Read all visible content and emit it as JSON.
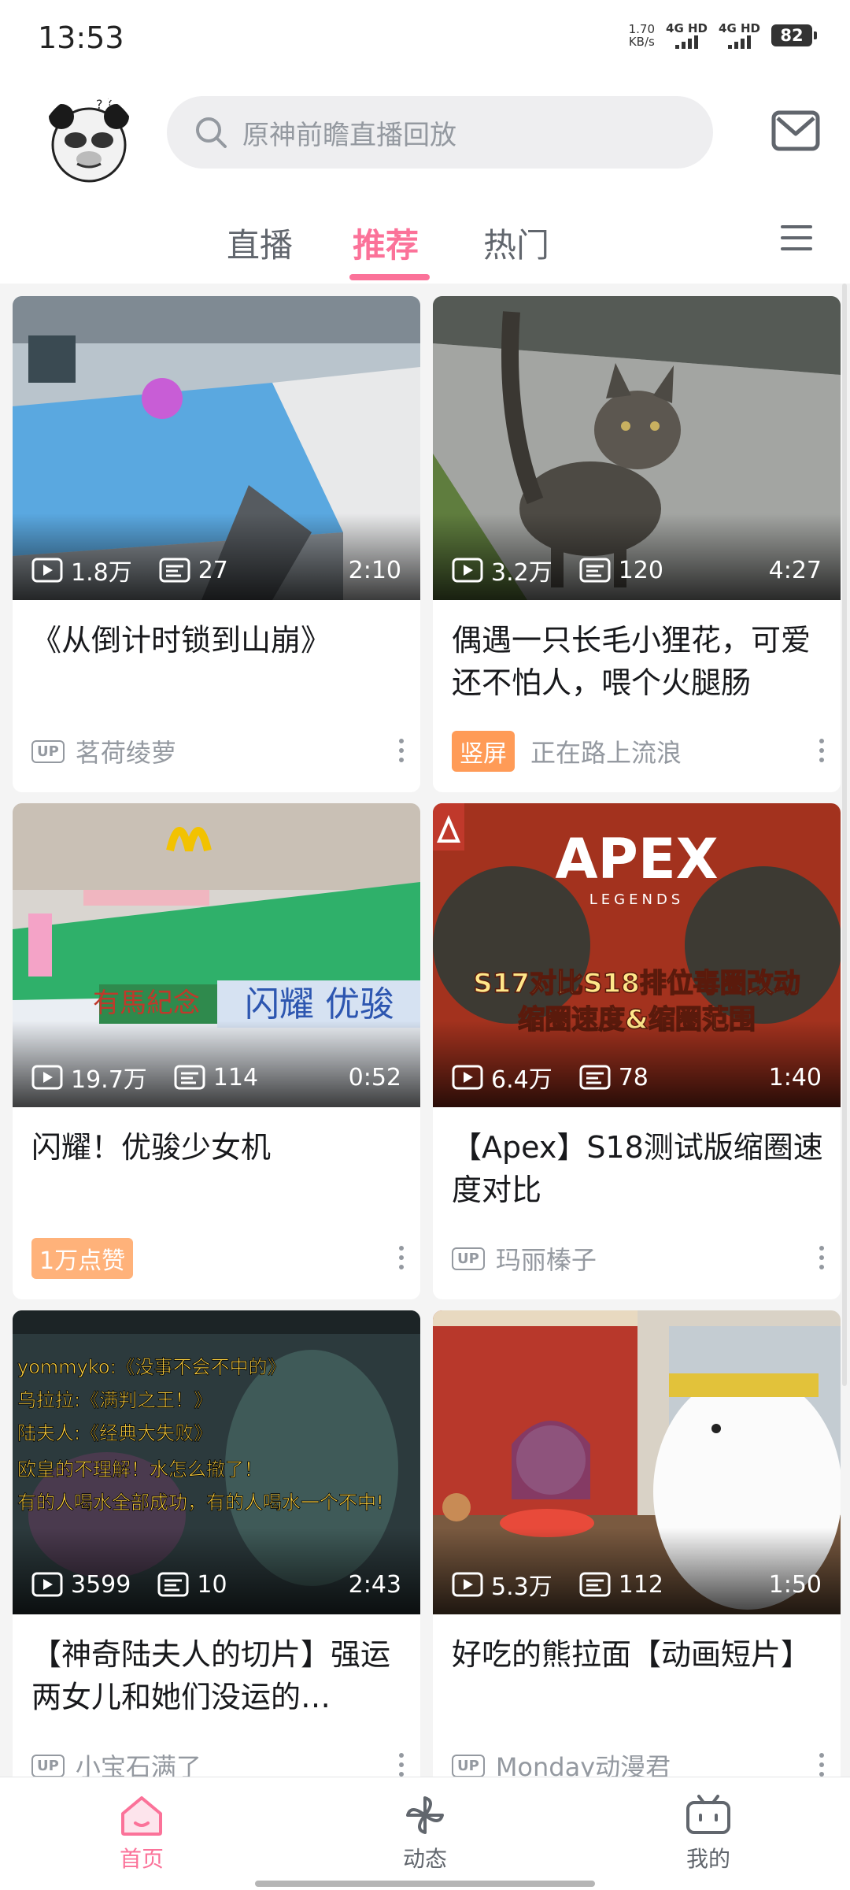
{
  "status_bar": {
    "time": "13:53",
    "net_speed_value": "1.70",
    "net_speed_unit": "KB/s",
    "sig1": "4G HD",
    "sig2": "4G HD",
    "battery": "82"
  },
  "header": {
    "search_placeholder": "原神前瞻直播回放"
  },
  "tabs": [
    {
      "label": "直播"
    },
    {
      "label": "推荐"
    },
    {
      "label": "热门"
    }
  ],
  "active_tab": "推荐",
  "accent_color": "#fb7299",
  "feed": [
    {
      "views": "1.8万",
      "comments": "27",
      "duration": "2:10",
      "title": "《从倒计时锁到山崩》",
      "badge": "UP",
      "tag": "",
      "author": "茗荷绫萝"
    },
    {
      "views": "3.2万",
      "comments": "120",
      "duration": "4:27",
      "title": "偶遇一只长毛小狸花，可爱还不怕人，喂个火腿肠",
      "badge": "",
      "tag": "竖屏",
      "author": "正在路上流浪"
    },
    {
      "views": "19.7万",
      "comments": "114",
      "duration": "0:52",
      "title": "闪耀！优骏少女机",
      "badge": "",
      "tag": "1万点赞",
      "author": ""
    },
    {
      "views": "6.4万",
      "comments": "78",
      "duration": "1:40",
      "title": "【Apex】S18测试版缩圈速度对比",
      "badge": "UP",
      "tag": "",
      "author": "玛丽榛子"
    },
    {
      "views": "3599",
      "comments": "10",
      "duration": "2:43",
      "title": "【神奇陆夫人的切片】强运两女儿和她们没运的…",
      "badge": "UP",
      "tag": "",
      "author": "小宝石满了"
    },
    {
      "views": "5.3万",
      "comments": "112",
      "duration": "1:50",
      "title": "好吃的熊拉面【动画短片】",
      "badge": "UP",
      "tag": "",
      "author": "Monday动漫君"
    }
  ],
  "thumb_text": {
    "apex_logo": "APEX",
    "apex_sub": "LEGENDS",
    "apex_line1": "S17对比S18排位毒圈改动",
    "apex_line2": "缩圈速度&缩圈范围",
    "horse_sign1": "闪耀 优骏",
    "horse_sign2": "有馬紀念",
    "chat1": "yommyko:《没事不会不中的》",
    "chat2": "乌拉拉:《满判之王！》",
    "chat3": "陆夫人:《经典大失败》",
    "chat4": "欧皇的不理解！水怎么撤了！",
    "chat5": "有的人喝水全部成功，有的人喝水一个不中!"
  },
  "bottom_nav": [
    {
      "label": "首页",
      "icon": "home-icon"
    },
    {
      "label": "动态",
      "icon": "pinwheel-icon"
    },
    {
      "label": "我的",
      "icon": "tv-icon"
    }
  ]
}
